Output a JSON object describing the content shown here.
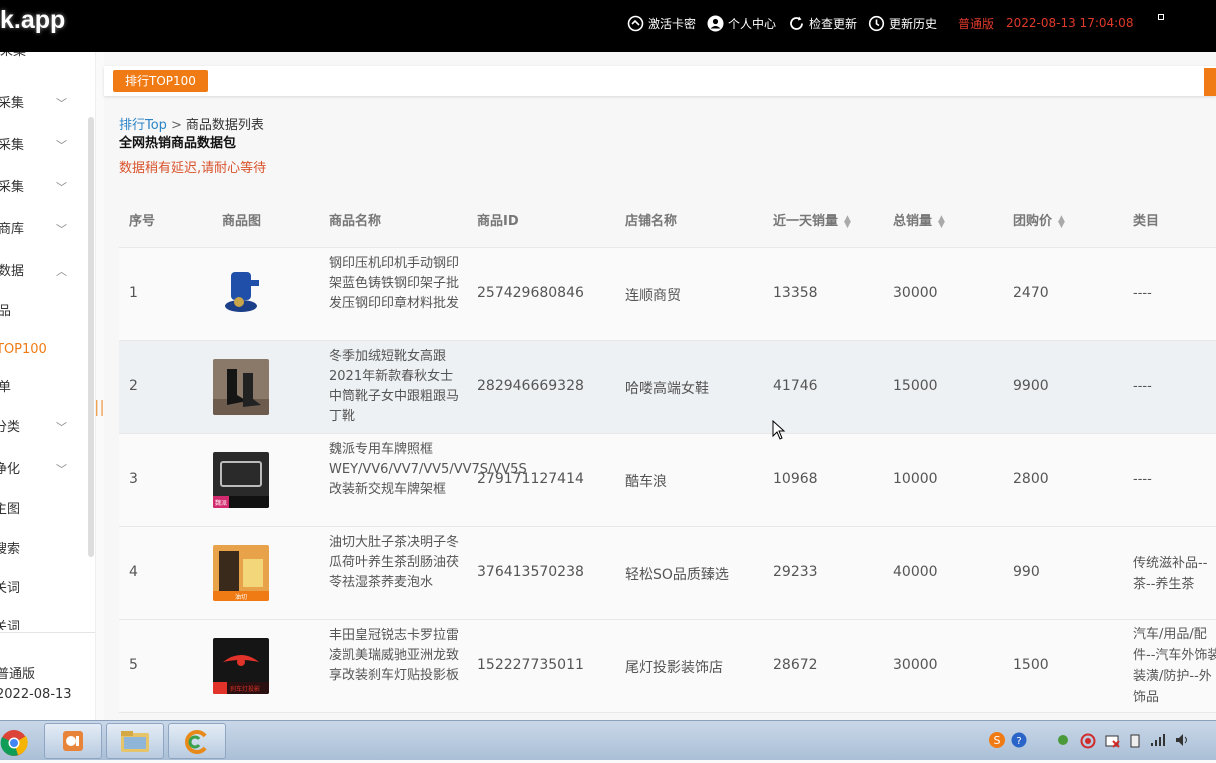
{
  "topbar": {
    "logo": "k.app",
    "activate": "激活卡密",
    "profile": "个人中心",
    "check_update": "检查更新",
    "history": "更新历史",
    "edition": "普通版",
    "datetime": "2022-08-13 17:04:08"
  },
  "sidebar": {
    "items": [
      {
        "label": "采集"
      },
      {
        "label": "采集"
      },
      {
        "label": "采集"
      },
      {
        "label": "商库"
      },
      {
        "label": "数据"
      },
      {
        "label": "品"
      },
      {
        "label": "TOP100"
      },
      {
        "label": "单"
      },
      {
        "label": "分类"
      },
      {
        "label": "净化"
      },
      {
        "label": "主图"
      },
      {
        "label": "搜索"
      },
      {
        "label": "关词"
      },
      {
        "label": "关词"
      }
    ],
    "footer_edition": "普通版",
    "footer_date": "2022-08-13"
  },
  "tabs": [
    {
      "label": "排行TOP100"
    }
  ],
  "breadcrumb": {
    "link": "排行Top",
    "separator": ">",
    "current": "商品数据列表"
  },
  "page": {
    "title": "全网热销商品数据包",
    "notice": "数据稍有延迟,请耐心等待"
  },
  "table": {
    "headers": {
      "index": "序号",
      "image": "商品图",
      "name": "商品名称",
      "id": "商品ID",
      "shop": "店铺名称",
      "day_sales": "近一天销量",
      "total_sales": "总销量",
      "group_price": "团购价",
      "category": "类目"
    },
    "rows": [
      {
        "index": "1",
        "name": "钢印压机印机手动钢印架蓝色铸铁钢印架子批发压钢印印章材料批发",
        "id": "257429680846",
        "shop": "连顺商贸",
        "day_sales": "13358",
        "total_sales": "30000",
        "group_price": "2470",
        "category": "----"
      },
      {
        "index": "2",
        "name": "冬季加绒短靴女高跟2021年新款春秋女士中筒靴子女中跟粗跟马丁靴",
        "id": "282946669328",
        "shop": "哈喽高端女鞋",
        "day_sales": "41746",
        "total_sales": "15000",
        "group_price": "9900",
        "category": "----"
      },
      {
        "index": "3",
        "name": "魏派专用车牌照框WEY/VV6/VV7/VV5/VV7S/VV5S改装新交规车牌架框",
        "id": "279171127414",
        "shop": "酷车浪",
        "day_sales": "10968",
        "total_sales": "10000",
        "group_price": "2800",
        "category": "----"
      },
      {
        "index": "4",
        "name": "油切大肚子茶决明子冬瓜荷叶养生茶刮肠油茯苓祛湿茶荞麦泡水",
        "id": "376413570238",
        "shop": "轻松SO品质臻选",
        "day_sales": "29233",
        "total_sales": "40000",
        "group_price": "990",
        "category": "传统滋补品--茶--养生茶"
      },
      {
        "index": "5",
        "name": "丰田皇冠锐志卡罗拉雷凌凯美瑞威驰亚洲龙致享改装刹车灯贴投影板",
        "id": "152227735011",
        "shop": "尾灯投影装饰店",
        "day_sales": "28672",
        "total_sales": "30000",
        "group_price": "1500",
        "category": "汽车/用品/配件--汽车外饰装装潢/防护--外饰品"
      }
    ],
    "thumb_tags": {
      "r3": "魏派",
      "r4": "油切",
      "r5": "刹车灯投影"
    }
  },
  "colors": {
    "accent": "#f07b14",
    "link": "#2b84c6",
    "notice": "#d9532c",
    "edition": "#e03a2a"
  }
}
